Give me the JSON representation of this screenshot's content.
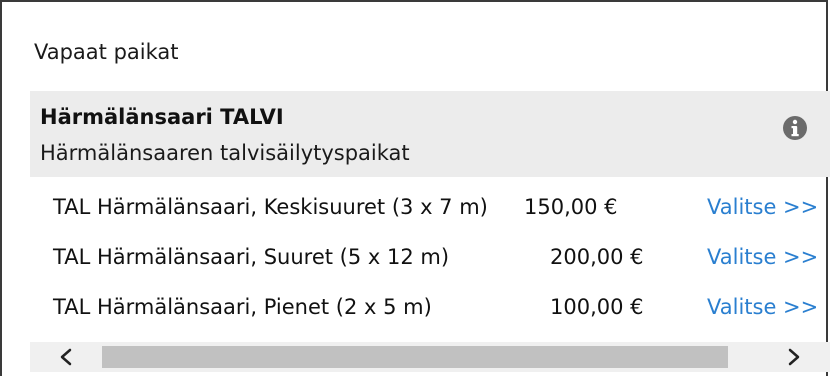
{
  "panel": {
    "title": "Vapaat paikat"
  },
  "category": {
    "name": "Härmälänsaari TALVI",
    "description": "Härmälänsaaren talvisäilytyspaikat",
    "icon": "info-icon"
  },
  "rows": [
    {
      "name": "TAL Härmälänsaari, Keskisuuret (3 x 7 m)",
      "price": "150,00 €",
      "action": "Valitse >>"
    },
    {
      "name": "TAL Härmälänsaari, Suuret (5 x 12 m)",
      "price": "200,00 €",
      "action": "Valitse >>"
    },
    {
      "name": "TAL Härmälänsaari, Pienet (2 x 5 m)",
      "price": "100,00 €",
      "action": "Valitse >>"
    }
  ],
  "scrollbar": {
    "left_icon": "chevron-left-icon",
    "right_icon": "chevron-right-icon"
  },
  "colors": {
    "link": "#2a7fd0",
    "category_bg": "#ececec",
    "scroll_track": "#f0f0f0",
    "scroll_thumb": "#c1c1c1"
  }
}
